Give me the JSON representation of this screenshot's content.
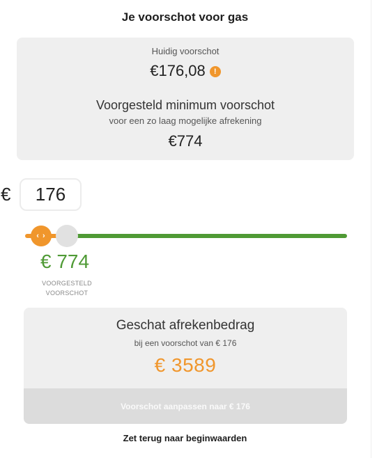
{
  "header": {
    "title": "Je voorschot voor gas"
  },
  "current": {
    "label": "Huidig voorschot",
    "amount": "€176,08",
    "warning_icon": "exclamation-circle-icon",
    "warning_glyph": "!"
  },
  "suggested": {
    "title": "Voorgesteld minimum voorschot",
    "subtitle": "voor een zo laag mogelijke afrekening",
    "amount": "€774"
  },
  "input": {
    "currency": "€",
    "value": "176"
  },
  "slider": {
    "handle_glyph": "‹ ›",
    "handle_icon": "chevron-left-right-icon",
    "value": 176,
    "suggested_value": 774,
    "colors": {
      "selected": "#f0962c",
      "track": "#4f9a35",
      "marker": "#e1e1e1"
    }
  },
  "suggestion": {
    "value": "€ 774",
    "label_line1": "VOORGESTELD",
    "label_line2": "VOORSCHOT"
  },
  "result": {
    "title": "Geschat afrekenbedrag",
    "subtitle": "bij een voorschot van € 176",
    "amount": "€ 3589",
    "button_label": "Voorschot aanpassen naar € 176"
  },
  "reset": {
    "label": "Zet terug naar beginwaarden"
  },
  "colors": {
    "orange": "#f0962c",
    "green": "#4f9a35",
    "card_bg": "#efefef",
    "button_bg": "#dcdcdc"
  }
}
